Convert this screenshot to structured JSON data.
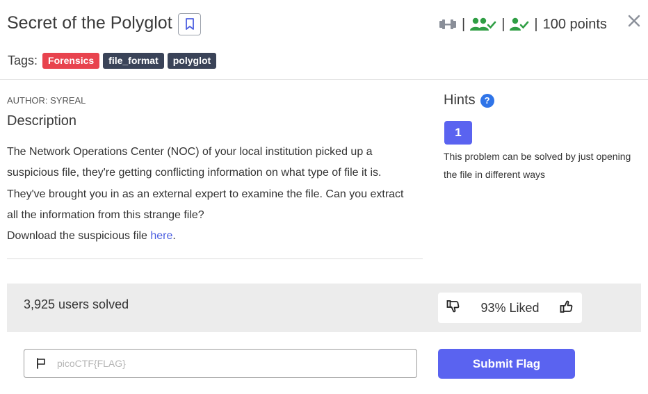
{
  "challenge": {
    "title": "Secret of the Polyglot",
    "points": "100 points",
    "tags_label": "Tags:",
    "tags": [
      "Forensics",
      "file_format",
      "polyglot"
    ],
    "author": "AUTHOR: SYREAL",
    "description_heading": "Description",
    "description_text": "The Network Operations Center (NOC) of your local institution picked up a suspicious file, they're getting conflicting information on what type of file it is. They've brought you in as an external expert to examine the file. Can you extract all the information from this strange file?",
    "download_prefix": "Download the suspicious file ",
    "download_link": "here",
    "download_suffix": "."
  },
  "hints": {
    "heading": "Hints",
    "help_glyph": "?",
    "items": [
      {
        "label": "1",
        "text": "This problem can be solved by just opening the file in different ways"
      }
    ]
  },
  "stats": {
    "solved": "3,925 users solved",
    "liked": "93% Liked"
  },
  "flag": {
    "placeholder": "picoCTF{FLAG}",
    "value": "",
    "submit_label": "Submit Flag"
  },
  "meta_separator": "|",
  "icons": {
    "bookmark": "bookmark-icon",
    "difficulty": "dumbbell-icon",
    "team": "users-check-icon",
    "user": "user-check-icon",
    "close": "close-icon",
    "dislike": "thumbs-down-icon",
    "like": "thumbs-up-icon",
    "flag": "flag-icon"
  },
  "colors": {
    "accent": "#5a63f0",
    "forensics_tag": "#e8434e",
    "dark_tag": "#3a4358",
    "success_green": "#2f9e44",
    "help_blue": "#2f74e8",
    "link": "#4c5fe0"
  }
}
